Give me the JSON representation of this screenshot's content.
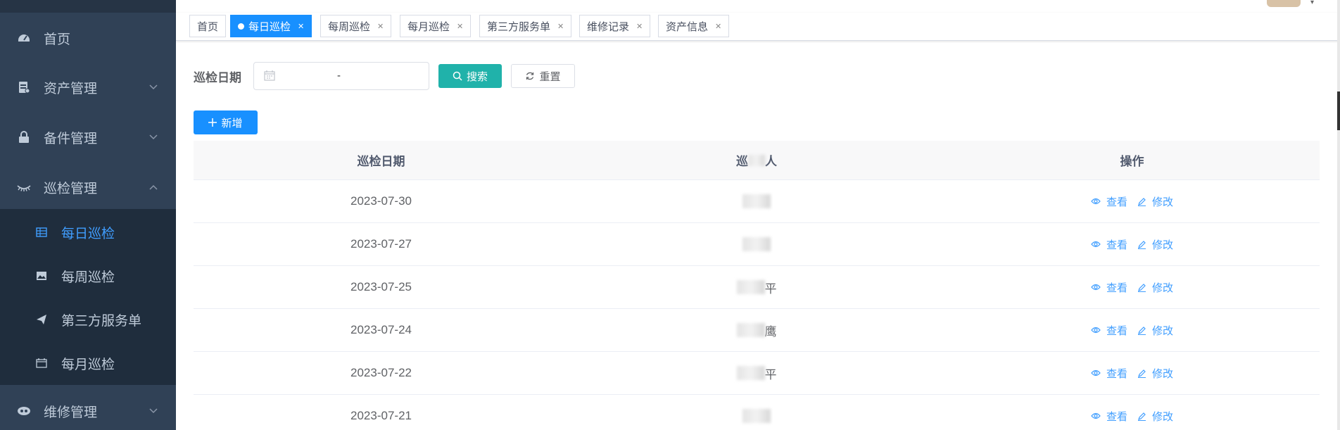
{
  "sidebar": {
    "items": [
      {
        "label": "首页",
        "icon": "dashboard-icon"
      },
      {
        "label": "资产管理",
        "icon": "asset-icon"
      },
      {
        "label": "备件管理",
        "icon": "lock-icon"
      },
      {
        "label": "巡检管理",
        "icon": "eye-icon"
      },
      {
        "label": "维修管理",
        "icon": "eye-mask-icon"
      }
    ],
    "sub_items": [
      {
        "label": "每日巡检",
        "icon": "table-icon"
      },
      {
        "label": "每周巡检",
        "icon": "image-icon"
      },
      {
        "label": "第三方服务单",
        "icon": "send-icon"
      },
      {
        "label": "每月巡检",
        "icon": "calendar-icon"
      }
    ]
  },
  "tags": [
    {
      "label": "首页"
    },
    {
      "label": "每日巡检"
    },
    {
      "label": "每周巡检"
    },
    {
      "label": "每月巡检"
    },
    {
      "label": "第三方服务单"
    },
    {
      "label": "维修记录"
    },
    {
      "label": "资产信息"
    }
  ],
  "search": {
    "date_label": "巡检日期",
    "range_separator": "-",
    "search_button": "搜索",
    "reset_button": "重置",
    "add_button": "新增"
  },
  "table": {
    "headers": [
      "巡检日期",
      "巡",
      "人",
      "操作"
    ],
    "view_label": "查看",
    "edit_label": "修改",
    "rows": [
      {
        "date": "2023-07-30",
        "name_suffix": ""
      },
      {
        "date": "2023-07-27",
        "name_suffix": ""
      },
      {
        "date": "2023-07-25",
        "name_suffix": "平"
      },
      {
        "date": "2023-07-24",
        "name_suffix": "鹰"
      },
      {
        "date": "2023-07-22",
        "name_suffix": "平"
      },
      {
        "date": "2023-07-21",
        "name_suffix": ""
      }
    ]
  },
  "colors": {
    "sidebar_bg": "#304156",
    "submenu_bg": "#1f2d3d",
    "active_blue": "#1890ff",
    "search_teal": "#20b2aa",
    "link_blue": "#409eff"
  }
}
